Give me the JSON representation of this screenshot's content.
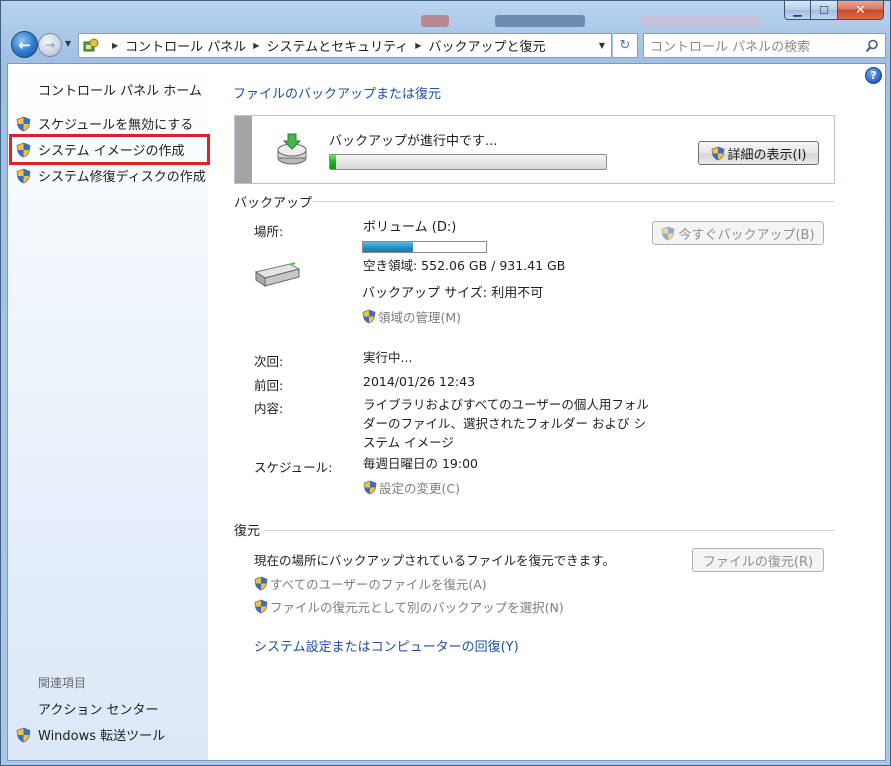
{
  "titlebar": {
    "minimize_glyph": "▁",
    "maximize_glyph": "☐",
    "close_glyph": "✕"
  },
  "nav": {
    "back_glyph": "←",
    "forward_glyph": "→",
    "breadcrumbs": [
      "コントロール パネル",
      "システムとセキュリティ",
      "バックアップと復元"
    ],
    "search_placeholder": "コントロール パネルの検索",
    "refresh_glyph": "↻"
  },
  "sidebar": {
    "home": "コントロール パネル ホーム",
    "tasks": [
      "スケジュールを無効にする",
      "システム イメージの作成",
      "システム修復ディスクの作成"
    ],
    "related_heading": "関連項目",
    "related": [
      "アクション センター",
      "Windows 転送ツール"
    ]
  },
  "help_glyph": "?",
  "main": {
    "title": "ファイルのバックアップまたは復元",
    "progress": {
      "text": "バックアップが進行中です...",
      "value_fraction": 0.02,
      "details_button": "詳細の表示(I)"
    },
    "backup": {
      "heading": "バックアップ",
      "location_label": "場所:",
      "volume": "ボリューム (D:)",
      "volume_used_fraction": 0.41,
      "free_space": "空き領域: 552.06 GB / 931.41 GB",
      "backup_size": "バックアップ サイズ: 利用不可",
      "manage_space": "領域の管理(M)",
      "backup_now_button": "今すぐバックアップ(B)",
      "next_label": "次回:",
      "next_value": "実行中...",
      "last_label": "前回:",
      "last_value": "2014/01/26 12:43",
      "contents_label": "内容:",
      "contents_value_lines": [
        "ライブラリおよびすべてのユーザーの個人用フォル",
        "ダーのファイル、選択されたフォルダー および シ",
        "ステム イメージ"
      ],
      "schedule_label": "スケジュール:",
      "schedule_value": "毎週日曜日の 19:00",
      "change_settings": "設定の変更(C)"
    },
    "restore": {
      "heading": "復元",
      "description": "現在の場所にバックアップされているファイルを復元できます。",
      "restore_files_button": "ファイルの復元(R)",
      "restore_all_users": "すべてのユーザーのファイルを復元(A)",
      "select_other_backup": "ファイルの復元元として別のバックアップを選択(N)",
      "recover_system": "システム設定またはコンピューターの回復(Y)"
    }
  },
  "colors": {
    "link_blue": "#1e4fa3",
    "highlight_red": "#e0202a",
    "progress_green": "#1fb11f"
  }
}
